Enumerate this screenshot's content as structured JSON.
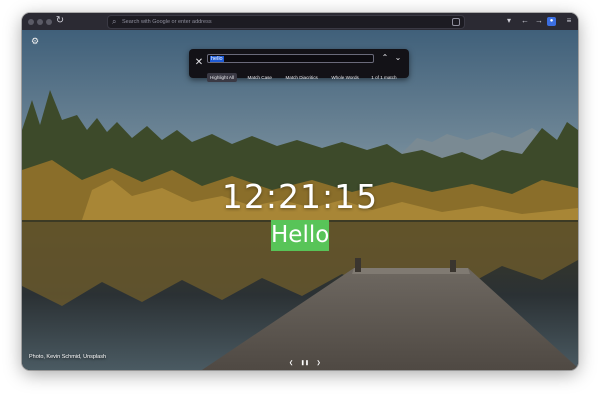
{
  "browser": {
    "url_placeholder": "Search with Google or enter address",
    "toolbar_icons": [
      "reload-icon",
      "reader-icon",
      "back-icon",
      "forward-icon",
      "extension-icon",
      "menu-icon"
    ]
  },
  "findbar": {
    "query": "hello",
    "options": [
      {
        "label": "Highlight All",
        "active": true
      },
      {
        "label": "Match Case",
        "active": false
      },
      {
        "label": "Match Diacritics",
        "active": false
      },
      {
        "label": "Whole Words",
        "active": false
      }
    ],
    "match_count": "1 of 1 match"
  },
  "page": {
    "clock": "12:21:15",
    "greeting": "Hello",
    "greeting_highlight_color": "#58c458",
    "photo_credit": "Photo, Kevin Schmid, Unsplash"
  },
  "icons": {
    "settings": "gear-icon",
    "find_close": "close-icon",
    "find_prev": "chevron-up-icon",
    "find_next": "chevron-down-icon",
    "photo_prev": "chevron-left-icon",
    "photo_pause": "pause-icon",
    "photo_next": "chevron-right-icon"
  }
}
